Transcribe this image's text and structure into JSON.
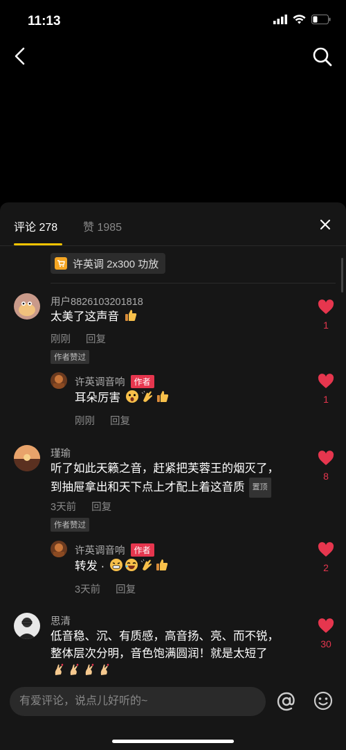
{
  "status": {
    "time": "11:13"
  },
  "tabs": {
    "comments": "评论 278",
    "likes": "赞 1985"
  },
  "product": {
    "label": "许英调 2x300 功放"
  },
  "comments": [
    {
      "user": "用户8826103201818",
      "text": "太美了这声音",
      "time": "刚刚",
      "reply": "回复",
      "badge": "作者赞过",
      "likes": "1"
    },
    {
      "user": "许英调音响",
      "author_tag": "作者",
      "text": "耳朵厉害",
      "time": "刚刚",
      "reply": "回复",
      "likes": "1"
    },
    {
      "user": "瑾瑜",
      "text_line1": "听了如此天籁之音，赶紧把芙蓉王的烟灭了，",
      "text_line2": "到抽屉拿出和天下点上才配上着这音质",
      "pin": "置顶",
      "time": "3天前",
      "reply": "回复",
      "badge": "作者赞过",
      "likes": "8"
    },
    {
      "user": "许英调音响",
      "author_tag": "作者",
      "text": "转发 ·",
      "time": "3天前",
      "reply": "回复",
      "likes": "2"
    },
    {
      "user": "思清",
      "text_line1": "低音稳、沉、有质感，高音扬、亮、而不锐，",
      "text_line2": "整体层次分明，音色饱满圆润！就是太短了",
      "likes": "30"
    }
  ],
  "input": {
    "placeholder": "有爱评论，说点儿好听的~"
  },
  "colors": {
    "accent": "#f5c400",
    "like": "#e6364e"
  }
}
